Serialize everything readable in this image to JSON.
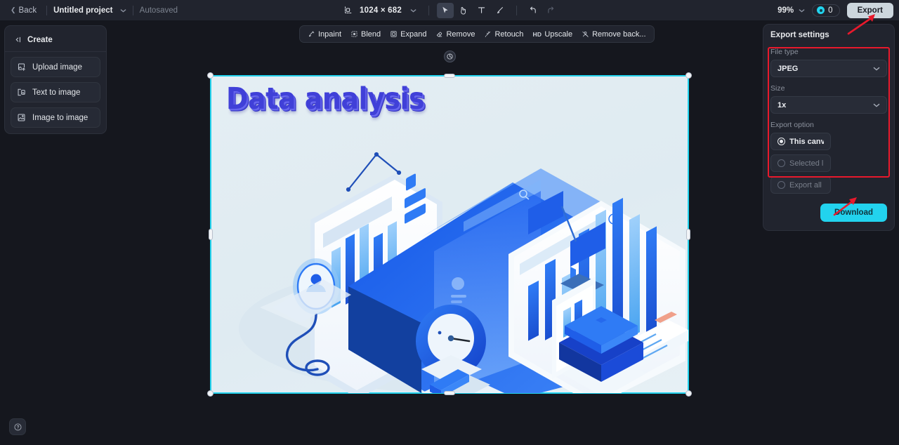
{
  "topbar": {
    "back_label": "Back",
    "project_name": "Untitled project",
    "autosaved_label": "Autosaved",
    "canvas_dimensions": "1024 × 682",
    "zoom_level": "99%",
    "credits_count": "0",
    "export_label": "Export",
    "tools": [
      {
        "name": "crop-icon",
        "label": "Crop",
        "active": false
      },
      {
        "name": "select-cursor-icon",
        "label": "Select",
        "active": true
      },
      {
        "name": "hand-pan-icon",
        "label": "Pan",
        "active": false
      },
      {
        "name": "text-tool-icon",
        "label": "Text",
        "active": false
      },
      {
        "name": "brush-tool-icon",
        "label": "Brush",
        "active": false
      },
      {
        "name": "undo-icon",
        "label": "Undo",
        "active": false
      },
      {
        "name": "redo-icon",
        "label": "Redo",
        "active": false
      }
    ]
  },
  "sidebar": {
    "header": "Create",
    "items": [
      {
        "label": "Upload image",
        "icon": "upload-image-icon"
      },
      {
        "label": "Text to image",
        "icon": "text-to-image-icon"
      },
      {
        "label": "Image to image",
        "icon": "image-to-image-icon"
      }
    ],
    "help_label": "?"
  },
  "context_toolbar": {
    "items": [
      {
        "label": "Inpaint",
        "icon": "inpaint-icon"
      },
      {
        "label": "Blend",
        "icon": "blend-icon"
      },
      {
        "label": "Expand",
        "icon": "expand-icon"
      },
      {
        "label": "Remove",
        "icon": "remove-eraser-icon"
      },
      {
        "label": "Retouch",
        "icon": "retouch-icon"
      },
      {
        "label": "Upscale",
        "icon": "hd-upscale-icon",
        "badge": "HD"
      },
      {
        "label": "Remove back...",
        "icon": "remove-background-icon"
      }
    ]
  },
  "artboard": {
    "title_text": "Data analysis",
    "selected": true,
    "accent_color": "#22d3ee",
    "background_color": "#e2edf3"
  },
  "export_settings": {
    "panel_title": "Export settings",
    "file_type_label": "File type",
    "file_type_value": "JPEG",
    "size_label": "Size",
    "size_value": "1x",
    "export_option_label": "Export option",
    "options": [
      {
        "label": "This canvas",
        "selected": true
      },
      {
        "label": "Selected l...",
        "selected": false
      },
      {
        "label": "Export all ...",
        "selected": false
      }
    ],
    "download_label": "Download",
    "download_color": "#22d3ee"
  },
  "annotations": {
    "highlight_color": "#e8192c",
    "arrow_count": "2"
  }
}
